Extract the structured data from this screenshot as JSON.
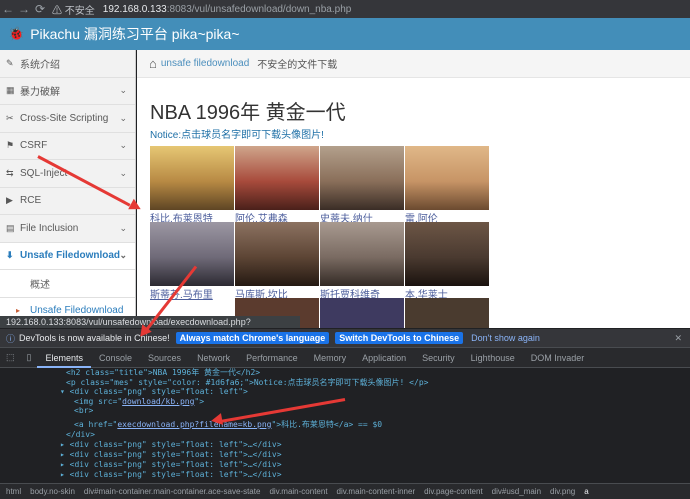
{
  "browser": {
    "back": "←",
    "forward": "→",
    "reload": "⟳",
    "security_text": "不安全",
    "url_host": "192.168.0.133",
    "url_rest": ":8083/vul/unsafedownload/down_nba.php"
  },
  "header": {
    "logo": "🐞",
    "title": "Pikachu 漏洞练习平台 pika~pika~"
  },
  "sidebar": {
    "items": [
      {
        "icon": "✎",
        "label": "系统介绍"
      },
      {
        "icon": "▦",
        "label": "暴力破解"
      },
      {
        "icon": "✂",
        "label": "Cross-Site Scripting"
      },
      {
        "icon": "⚑",
        "label": "CSRF"
      },
      {
        "icon": "⇆",
        "label": "SQL-Inject"
      },
      {
        "icon": "▶",
        "label": "RCE"
      },
      {
        "icon": "▤",
        "label": "File Inclusion"
      },
      {
        "icon": "⬇",
        "label": "Unsafe Filedownload"
      }
    ],
    "sub": [
      {
        "label": "概述"
      },
      {
        "label": "Unsafe Filedownload"
      }
    ]
  },
  "breadcrumb": {
    "home_icon": "⌂",
    "link": "unsafe filedownload",
    "current": "不安全的文件下载"
  },
  "page": {
    "title": "NBA 1996年 黄金一代",
    "notice": "Notice:点击球员名字即可下载头像图片!"
  },
  "players": [
    {
      "name": "科比.布莱恩特",
      "color": "#c9a35a"
    },
    {
      "name": "阿伦.艾弗森",
      "color": "#a84b3c"
    },
    {
      "name": "史蒂夫.纳什",
      "color": "#8a6f5a"
    },
    {
      "name": "雷.阿伦",
      "color": "#c79466"
    },
    {
      "name": "斯蒂芬.马布里",
      "color": "#6f6a78"
    },
    {
      "name": "马库斯.坎比",
      "color": "#5d4535"
    },
    {
      "name": "斯托贾科维奇",
      "color": "#7a6b62"
    },
    {
      "name": "本.华莱士",
      "color": "#4a3a30"
    }
  ],
  "status_bar": "192.168.0.133:8083/vul/unsafedownload/execdownload.php?filename=kb.png",
  "devtools_info": {
    "text": "DevTools is now available in Chinese!",
    "btn1": "Always match Chrome's language",
    "btn2": "Switch DevTools to Chinese",
    "btn3": "Don't show again",
    "close": "✕"
  },
  "devtools_tabs": [
    "Elements",
    "Console",
    "Sources",
    "Network",
    "Performance",
    "Memory",
    "Application",
    "Security",
    "Lighthouse",
    "DOM Invader"
  ],
  "code_lines": {
    "l1": "<h2 class=\"title\">NBA 1996年 黄金一代</h2>",
    "l2": "<p class=\"mes\" style=\"color: #1d6fa6;\">Notice:点击球员名字即可下载头像图片! </p>",
    "l3": "▾ <div class=\"png\" style=\"float: left\">",
    "l4a": "<img src=\"",
    "l4b": "download/kb.png",
    "l4c": "\">",
    "l5": "<br>",
    "l6a": "<a href=\"",
    "l6b": "execdownload.php?filename=kb.png",
    "l6c": "\">科比.布莱恩特</a> == $0",
    "l7": "</div>",
    "l8": "▸ <div class=\"png\" style=\"float: left\">…</div>",
    "l9": "▸ <div class=\"png\" style=\"float: left\">…</div>",
    "l10": "▸ <div class=\"png\" style=\"float: left\">…</div>",
    "l11": "▸ <div class=\"png\" style=\"float: left\">…</div>"
  },
  "dom_crumbs": [
    "html",
    "body.no-skin",
    "div#main-container.main-container.ace-save-state",
    "div.main-content",
    "div.main-content-inner",
    "div.page-content",
    "div#usd_main",
    "div.png",
    "a"
  ]
}
